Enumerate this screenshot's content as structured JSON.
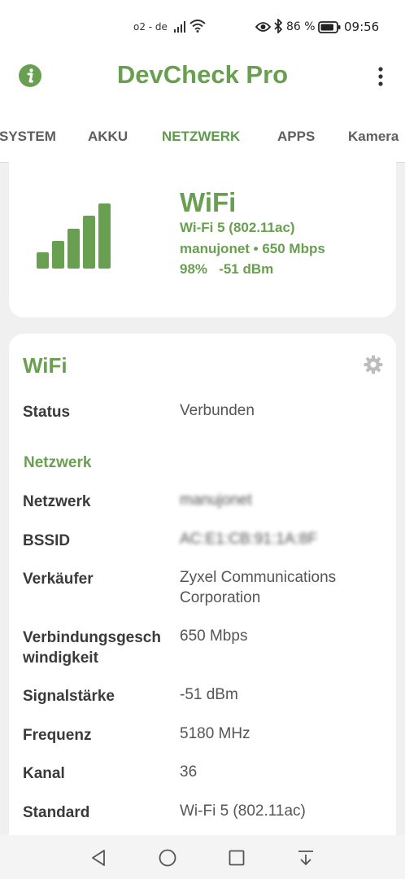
{
  "status_bar": {
    "carrier": "o2 - de",
    "battery_percent": "86 %",
    "battery_level": 0.86,
    "time": "09:56",
    "icons": [
      "signal-icon",
      "wifi-icon",
      "eye-icon",
      "bluetooth-icon",
      "battery-icon"
    ]
  },
  "app_bar": {
    "title": "DevCheck Pro",
    "left_icon": "info-icon",
    "right_icon": "more-vert-icon"
  },
  "tabs": [
    {
      "label": "SYSTEM",
      "active": false
    },
    {
      "label": "AKKU",
      "active": false
    },
    {
      "label": "NETZWERK",
      "active": true
    },
    {
      "label": "APPS",
      "active": false
    },
    {
      "label": "Kamera",
      "active": false
    }
  ],
  "summary": {
    "title": "WiFi",
    "line1": "Wi-Fi 5 (802.11ac)",
    "line2": "manujonet • 650 Mbps",
    "line3": "98%   -51 dBm",
    "signal_level": 0.98,
    "accent_color": "#689f51"
  },
  "details": {
    "title": "WiFi",
    "settings_icon": "gear-icon",
    "status_label": "Status",
    "status_value": "Verbunden",
    "section_title": "Netzwerk",
    "rows": [
      {
        "label": "Netzwerk",
        "value": "manujonet"
      },
      {
        "label": "BSSID",
        "value": "AC:E1:CB:91:1A:8F"
      },
      {
        "label": "Verkäufer",
        "value": "Zyxel Communications Corporation"
      },
      {
        "label": "Verbindungsgeschwindigkeit",
        "value": "650 Mbps"
      },
      {
        "label": "Signalstärke",
        "value": "-51 dBm"
      },
      {
        "label": "Frequenz",
        "value": "5180 MHz"
      },
      {
        "label": "Kanal",
        "value": "36"
      },
      {
        "label": "Standard",
        "value": "Wi-Fi 5 (802.11ac)"
      }
    ]
  },
  "nav_bar": {
    "buttons": [
      "back-icon",
      "home-icon",
      "recents-icon",
      "notification-pull-icon"
    ]
  }
}
